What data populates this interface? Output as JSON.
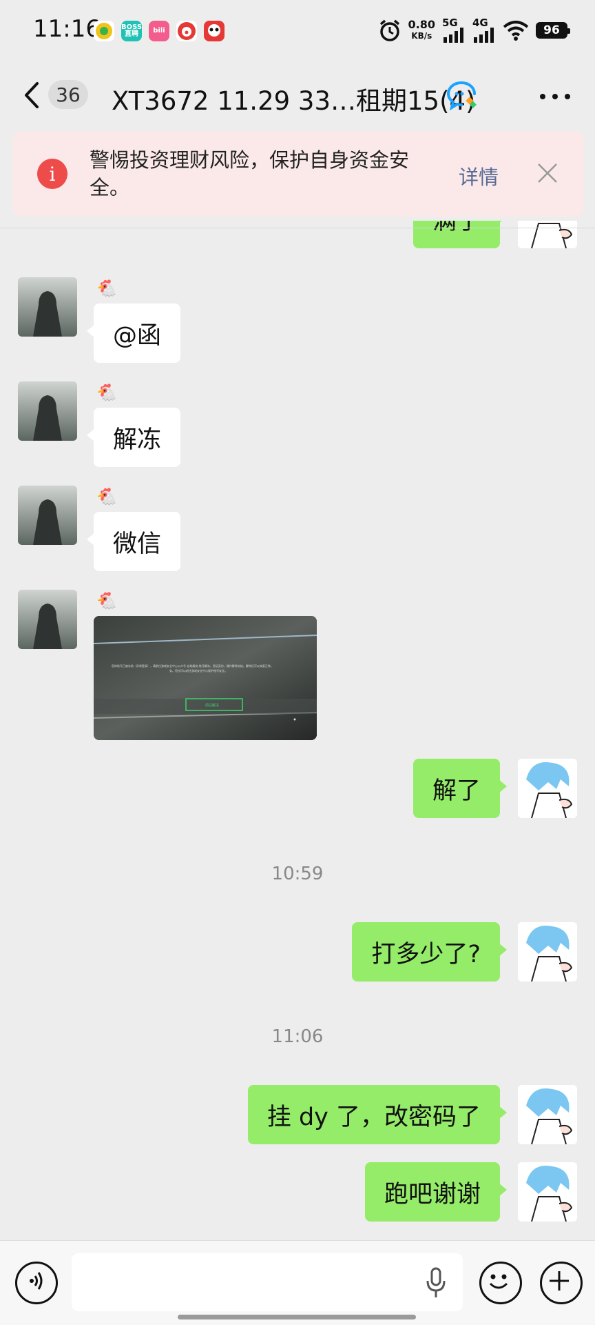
{
  "status_bar": {
    "time": "11:16",
    "apps": [
      {
        "name": "app-green-icon",
        "label": "",
        "color": "#f0c419"
      },
      {
        "name": "boss-app-icon",
        "label": "BOSS直聘",
        "color": "#1fc2b4"
      },
      {
        "name": "bilibili-app-icon",
        "label": "bili",
        "color": "#f25d8e"
      },
      {
        "name": "clown-app-icon",
        "label": "",
        "color": "#e53935"
      },
      {
        "name": "panda-app-icon",
        "label": "",
        "color": "#e53935"
      }
    ],
    "speed_value": "0.80",
    "speed_unit": "KB/s",
    "net1": "5G",
    "net2": "4G",
    "battery": "96"
  },
  "header": {
    "unread_count": "36",
    "title": "XT3672 11.29 33…租期15(4)"
  },
  "warning": {
    "text": "警惕投资理财风险，保护自身资金安全。",
    "detail_label": "详情"
  },
  "messages": {
    "partial_right": "满了",
    "m1_text": "@函",
    "m2_text": "解冻",
    "m3_text": "微信",
    "m5_text": "解了",
    "time1": "10:59",
    "m6_text": "打多少了?",
    "time2": "11:06",
    "m7_text": "挂 dy 了，改密码了",
    "m8_text": "跑吧谢谢",
    "sender_emoji": "🐔"
  },
  "image_message": {
    "line1": "您的账号已被冻结（异常登录），请前往游戏安全中心公众号-自助服务-账号解冻，验证身份，操作解除冻结。解除后可以恢复正常，",
    "line2": "务。您也可以前往游戏安全中心保护账号安全。",
    "button": "前往解冻"
  }
}
